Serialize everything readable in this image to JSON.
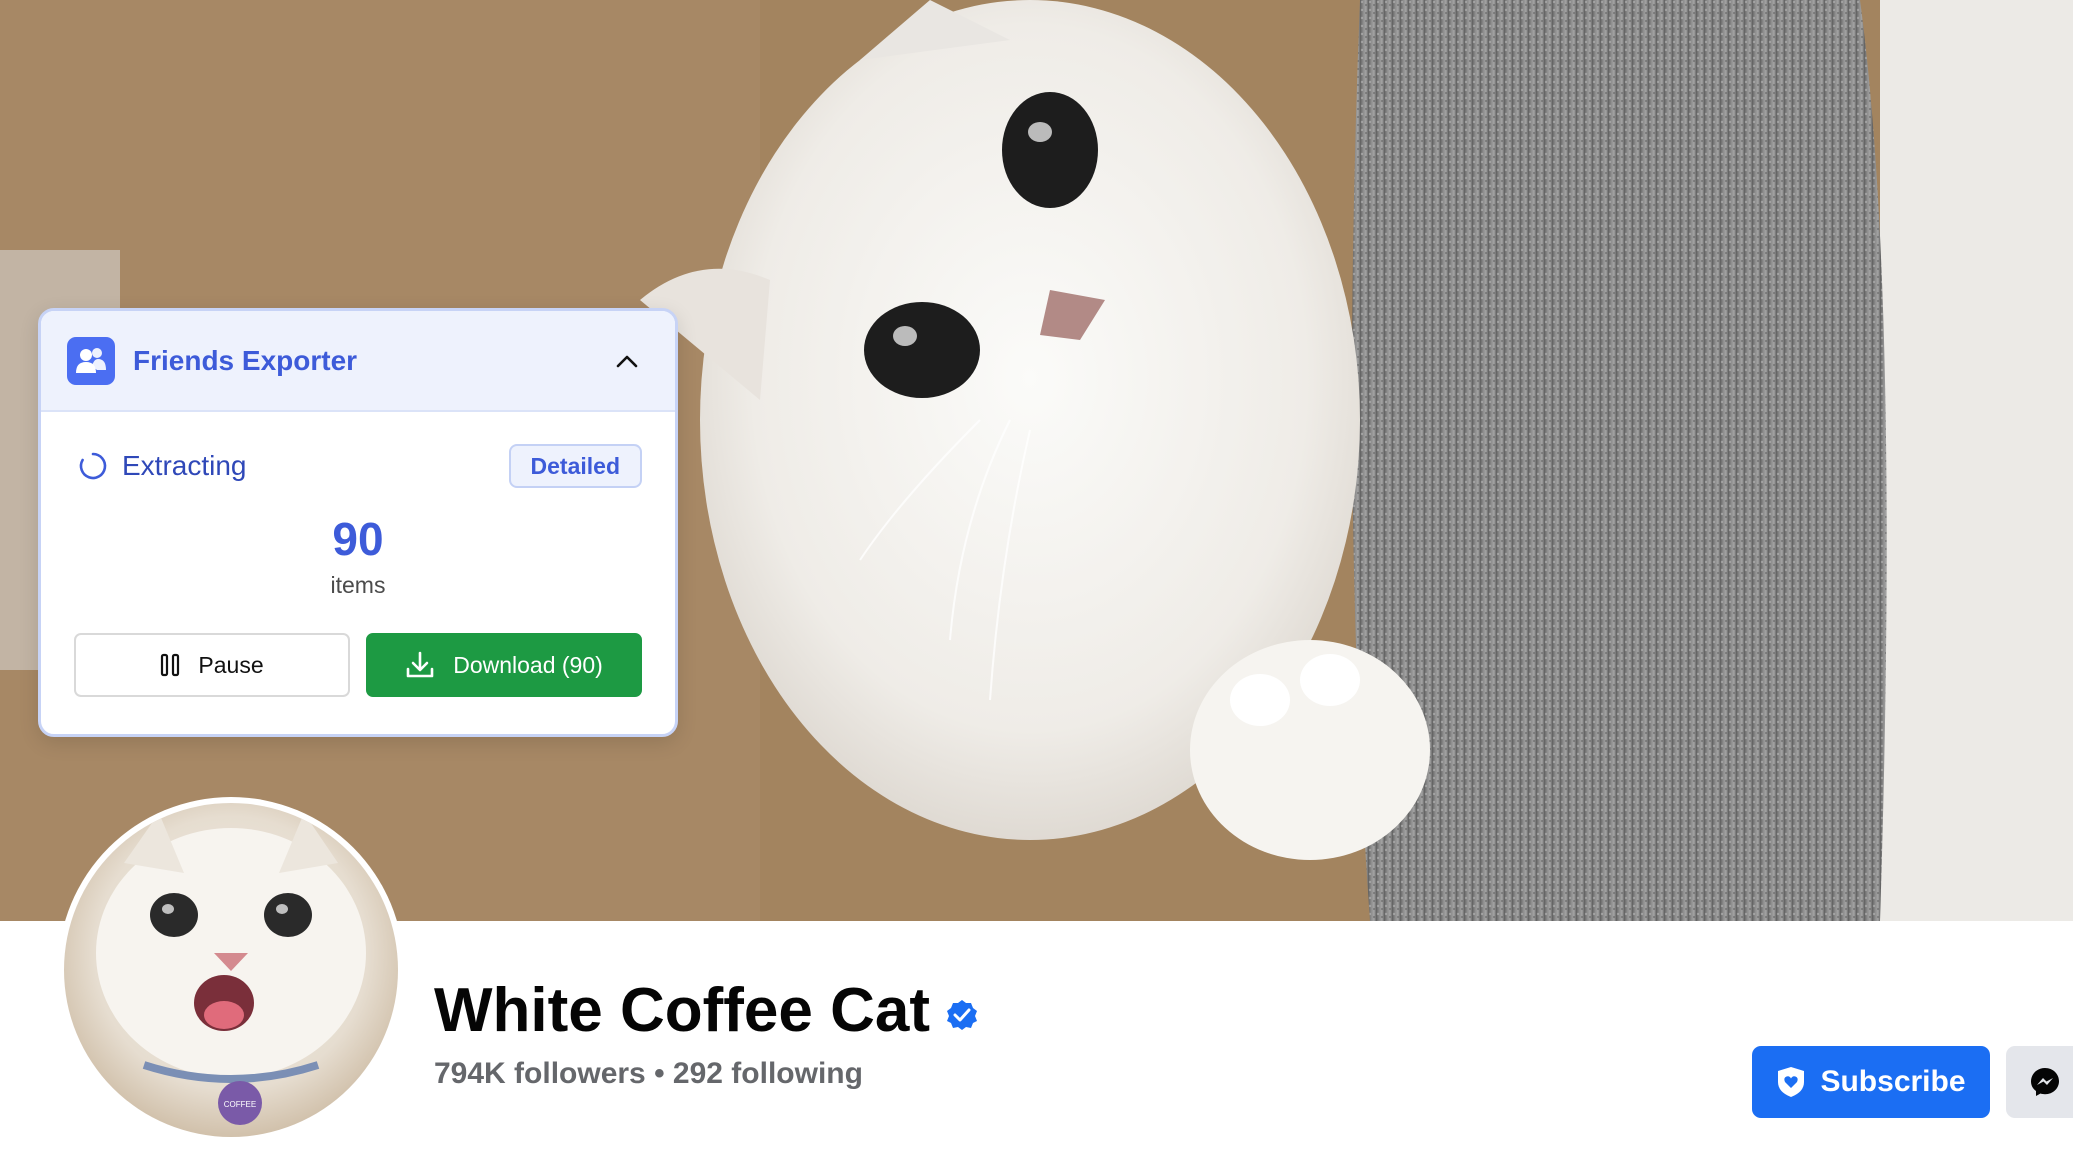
{
  "exporter": {
    "title": "Friends Exporter",
    "status": "Extracting",
    "mode_badge": "Detailed",
    "count": "90",
    "count_unit": "items",
    "pause_label": "Pause",
    "download_label": "Download (90)",
    "accent_color": "#3d5bd9",
    "download_color": "#1d9a43",
    "icons": [
      "users-icon",
      "chevron-up-icon",
      "spinner-icon",
      "pause-icon",
      "download-icon"
    ]
  },
  "profile": {
    "name": "White Coffee Cat",
    "stats": "794K followers • 292 following",
    "verified": true,
    "avatar_tag_text": "COFFEE",
    "subscribe_label": "Subscribe",
    "subscribe_color": "#1b6ef3",
    "icons": [
      "verified-badge-icon",
      "shield-heart-icon",
      "messenger-icon"
    ]
  }
}
